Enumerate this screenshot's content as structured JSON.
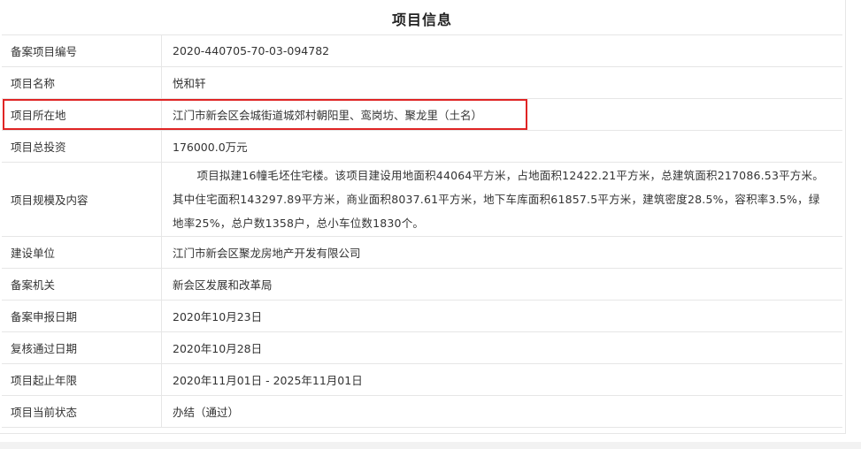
{
  "header": {
    "title": "项目信息"
  },
  "rows": [
    {
      "label": "备案项目编号",
      "value": "2020-440705-70-03-094782"
    },
    {
      "label": "项目名称",
      "value": "悦和轩"
    },
    {
      "label": "项目所在地",
      "value": "江门市新会区会城街道城郊村朝阳里、鸾岗坊、聚龙里（土名）"
    },
    {
      "label": "项目总投资",
      "value": "176000.0万元"
    },
    {
      "label": "项目规模及内容",
      "value": "项目拟建16幢毛坯住宅楼。该项目建设用地面积44064平方米，占地面积12422.21平方米，总建筑面积217086.53平方米。其中住宅面积143297.89平方米，商业面积8037.61平方米，地下车库面积61857.5平方米，建筑密度28.5%，容积率3.5%，绿地率25%，总户数1358户，总小车位数1830个。"
    },
    {
      "label": "建设单位",
      "value": "江门市新会区聚龙房地产开发有限公司"
    },
    {
      "label": "备案机关",
      "value": "新会区发展和改革局"
    },
    {
      "label": "备案申报日期",
      "value": "2020年10月23日"
    },
    {
      "label": "复核通过日期",
      "value": "2020年10月28日"
    },
    {
      "label": "项目起止年限",
      "value": "2020年11月01日 - 2025年11月01日"
    },
    {
      "label": "项目当前状态",
      "value": "办结（通过）"
    }
  ],
  "highlight": {
    "color": "#e02424"
  },
  "colors": {
    "border": "#e6e6e6",
    "text": "#333333"
  }
}
